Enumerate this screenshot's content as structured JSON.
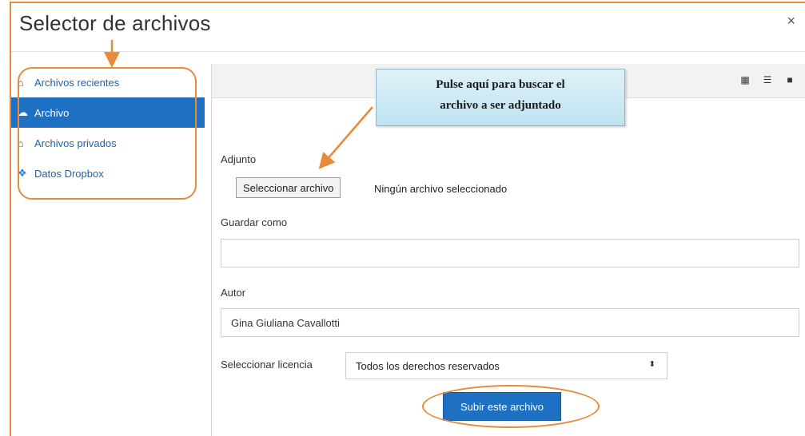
{
  "dialog": {
    "title": "Selector de archivos",
    "close_label": "×"
  },
  "sidebar": {
    "items": [
      {
        "label": "Archivos recientes",
        "icon": "repository-icon"
      },
      {
        "label": "Archivo",
        "icon": "upload-icon",
        "active": true
      },
      {
        "label": "Archivos privados",
        "icon": "repository-icon"
      },
      {
        "label": "Datos Dropbox",
        "icon": "dropbox-icon"
      }
    ]
  },
  "toolbar": {
    "views": [
      "icons-view-icon",
      "list-view-icon",
      "folder-view-icon"
    ]
  },
  "callout": {
    "line1": "Pulse aquí para buscar el",
    "line2": "archivo a ser adjuntado"
  },
  "form": {
    "attachment_label": "Adjunto",
    "choose_file_button": "Seleccionar archivo",
    "no_file_text": "Ningún archivo seleccionado",
    "save_as_label": "Guardar como",
    "save_as_value": "",
    "author_label": "Autor",
    "author_value": "Gina Giuliana Cavallotti",
    "license_label": "Seleccionar licencia",
    "license_value": "Todos los derechos reservados",
    "submit_label": "Subir este archivo"
  },
  "colors": {
    "accent": "#1e70c3",
    "annotation": "#e98a3a"
  }
}
